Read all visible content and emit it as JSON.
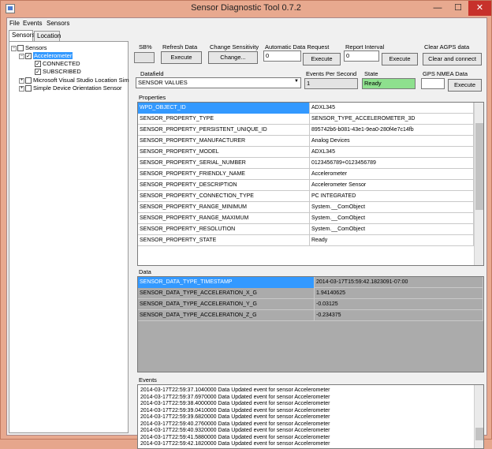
{
  "window": {
    "title": "Sensor Diagnostic Tool 0.7.2",
    "min_glyph": "—",
    "max_glyph": "☐",
    "close_glyph": "✕"
  },
  "menu": {
    "items": [
      "File",
      "Events",
      "Sensors"
    ]
  },
  "tabs": [
    {
      "label": "Sensors",
      "active": true
    },
    {
      "label": "Location",
      "active": false
    }
  ],
  "tree": {
    "root": {
      "label": "Sensors",
      "expander": "−"
    },
    "accelerometer": {
      "label": "Accelerometer",
      "expander": "−"
    },
    "connected": {
      "label": "CONNECTED"
    },
    "subscribed": {
      "label": "SUBSCRIBED"
    },
    "ms_location": {
      "label": "Microsoft Visual Studio Location Sim",
      "expander": "+"
    },
    "orientation": {
      "label": "Simple Device Orientation Sensor",
      "expander": "+"
    },
    "check_glyph": "✓"
  },
  "controls": {
    "sb_label": "SB%",
    "refresh": {
      "label": "Refresh Data",
      "button": "Execute"
    },
    "sensitivity": {
      "label": "Change Sensitivity",
      "button": "Change..."
    },
    "auto_request": {
      "label": "Automatic Data Request",
      "value": "0",
      "button": "Execute"
    },
    "report_interval": {
      "label": "Report Interval",
      "value": "0",
      "button": "Execute"
    },
    "clear_agps": {
      "label": "Clear AGPS data",
      "button": "Clear and connect"
    },
    "datafield": {
      "label": "Datafield",
      "value": "SENSOR VALUES",
      "arrow": "▼"
    },
    "events_per_second": {
      "label": "Events Per Second",
      "value": "1"
    },
    "state": {
      "label": "State",
      "value": "Ready"
    },
    "gps_nmea": {
      "label": "GPS NMEA Data",
      "value": "",
      "button": "Execute"
    }
  },
  "properties": {
    "label": "Properties",
    "rows": [
      {
        "key": "WPD_OBJECT_ID",
        "value": "ADXL345"
      },
      {
        "key": "SENSOR_PROPERTY_TYPE",
        "value": "SENSOR_TYPE_ACCELEROMETER_3D"
      },
      {
        "key": "SENSOR_PROPERTY_PERSISTENT_UNIQUE_ID",
        "value": "895742b6-b081-43e1-9ea0-280f4e7c14fb"
      },
      {
        "key": "SENSOR_PROPERTY_MANUFACTURER",
        "value": "Analog Devices"
      },
      {
        "key": "SENSOR_PROPERTY_MODEL",
        "value": "ADXL345"
      },
      {
        "key": "SENSOR_PROPERTY_SERIAL_NUMBER",
        "value": "0123456789+0123456789"
      },
      {
        "key": "SENSOR_PROPERTY_FRIENDLY_NAME",
        "value": "Accelerometer"
      },
      {
        "key": "SENSOR_PROPERTY_DESCRIPTION",
        "value": "Accelerometer Sensor"
      },
      {
        "key": "SENSOR_PROPERTY_CONNECTION_TYPE",
        "value": "PC INTEGRATED"
      },
      {
        "key": "SENSOR_PROPERTY_RANGE_MINIMUM",
        "value": "System.__ComObject"
      },
      {
        "key": "SENSOR_PROPERTY_RANGE_MAXIMUM",
        "value": "System.__ComObject"
      },
      {
        "key": "SENSOR_PROPERTY_RESOLUTION",
        "value": "System.__ComObject"
      },
      {
        "key": "SENSOR_PROPERTY_STATE",
        "value": "Ready"
      }
    ]
  },
  "data": {
    "label": "Data",
    "rows": [
      {
        "key": "SENSOR_DATA_TYPE_TIMESTAMP",
        "value": "2014-03-17T15:59:42.1823091-07:00"
      },
      {
        "key": "SENSOR_DATA_TYPE_ACCELERATION_X_G",
        "value": "1.94140625"
      },
      {
        "key": "SENSOR_DATA_TYPE_ACCELERATION_Y_G",
        "value": "-0.03125"
      },
      {
        "key": "SENSOR_DATA_TYPE_ACCELERATION_Z_G",
        "value": "-0.234375"
      }
    ]
  },
  "events": {
    "label": "Events",
    "lines": [
      "2014-03-17T22:59:37.1040000 Data Updated event for sensor Accelerometer",
      "2014-03-17T22:59:37.6970000 Data Updated event for sensor Accelerometer",
      "2014-03-17T22:59:38.4000000 Data Updated event for sensor Accelerometer",
      "2014-03-17T22:59:39.0410000 Data Updated event for sensor Accelerometer",
      "2014-03-17T22:59:39.6820000 Data Updated event for sensor Accelerometer",
      "2014-03-17T22:59:40.2760000 Data Updated event for sensor Accelerometer",
      "2014-03-17T22:59:40.9320000 Data Updated event for sensor Accelerometer",
      "2014-03-17T22:59:41.5880000 Data Updated event for sensor Accelerometer",
      "2014-03-17T22:59:42.1820000 Data Updated event for sensor Accelerometer"
    ]
  }
}
